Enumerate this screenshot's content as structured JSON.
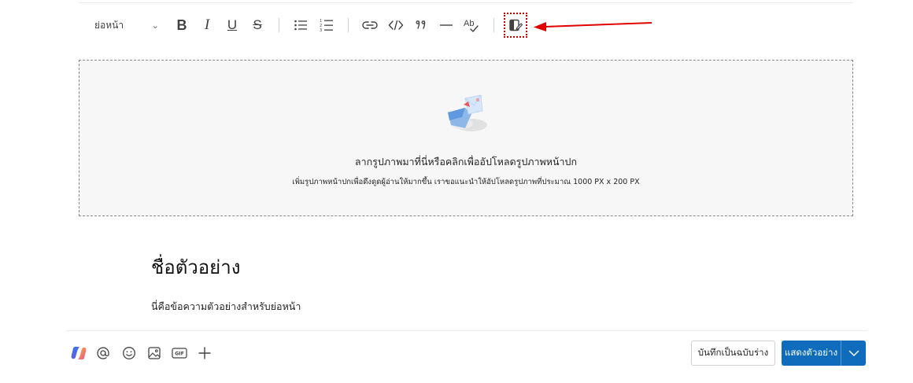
{
  "toolbar": {
    "style_label": "ย่อหน้า",
    "style_chevron": "⌄",
    "bold": "B",
    "italic": "I",
    "underline": "U",
    "strike": "S"
  },
  "dropzone": {
    "title": "ลากรูปภาพมาที่นี่หรือคลิกเพื่ออัปโหลดรูปภาพหน้าปก",
    "subtitle": "เพิ่มรูปภาพหน้าปกเพื่อดึงดูดผู้อ่านให้มากขึ้น เราขอแนะนำให้อัปโหลดรูปภาพที่ประมาณ 1000 PX x 200 PX"
  },
  "content": {
    "title": "ชื่อตัวอย่าง",
    "body": "นี่คือข้อความตัวอย่างสำหรับย่อหน้า"
  },
  "bottom": {
    "gif_label": "GIF",
    "draft_label": "บันทึกเป็นฉบับร่าง",
    "preview_label": "แสดงตัวอย่าง"
  },
  "colors": {
    "accent": "#0f6cbd",
    "highlight_border": "#c00000",
    "arrow": "#e00000"
  },
  "icons": [
    "bullet-list-icon",
    "numbered-list-icon",
    "link-icon",
    "code-icon",
    "quote-icon",
    "horizontal-rule-icon",
    "spellcheck-icon",
    "cover-image-edit-icon",
    "copilot-icon",
    "mention-icon",
    "emoji-icon",
    "image-icon",
    "gif-icon",
    "plus-icon",
    "chevron-down-icon"
  ]
}
